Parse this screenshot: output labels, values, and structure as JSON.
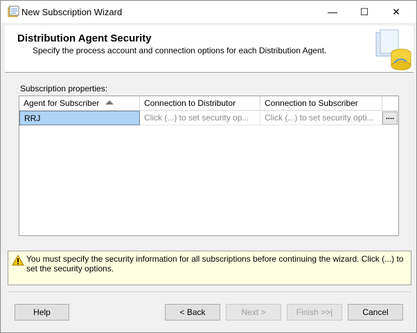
{
  "window": {
    "title": "New Subscription Wizard",
    "controls": {
      "minimize": "—",
      "maximize": "☐",
      "close": "✕"
    }
  },
  "header": {
    "title": "Distribution Agent Security",
    "subtitle": "Specify the process account and connection options for each Distribution Agent."
  },
  "grid": {
    "label": "Subscription properties:",
    "columns": [
      "Agent for Subscriber",
      "Connection to Distributor",
      "Connection to Subscriber"
    ],
    "sorted_column": "Agent for Subscriber",
    "rows": [
      {
        "agent": "RRJ",
        "distributor": "Click (...) to set security op...",
        "subscriber": "Click (...) to set security opti...",
        "ellipsis": "...."
      }
    ]
  },
  "warning": {
    "text": "You must specify the security information for all subscriptions before continuing the wizard. Click (...) to set the security options."
  },
  "buttons": {
    "help": "Help",
    "back": "< Back",
    "next": "Next >",
    "finish": "Finish >>|",
    "cancel": "Cancel"
  },
  "colors": {
    "selected_row": "#aed3f5",
    "warning_bg": "#ffffe1",
    "disabled_text": "#a0a0a0"
  }
}
